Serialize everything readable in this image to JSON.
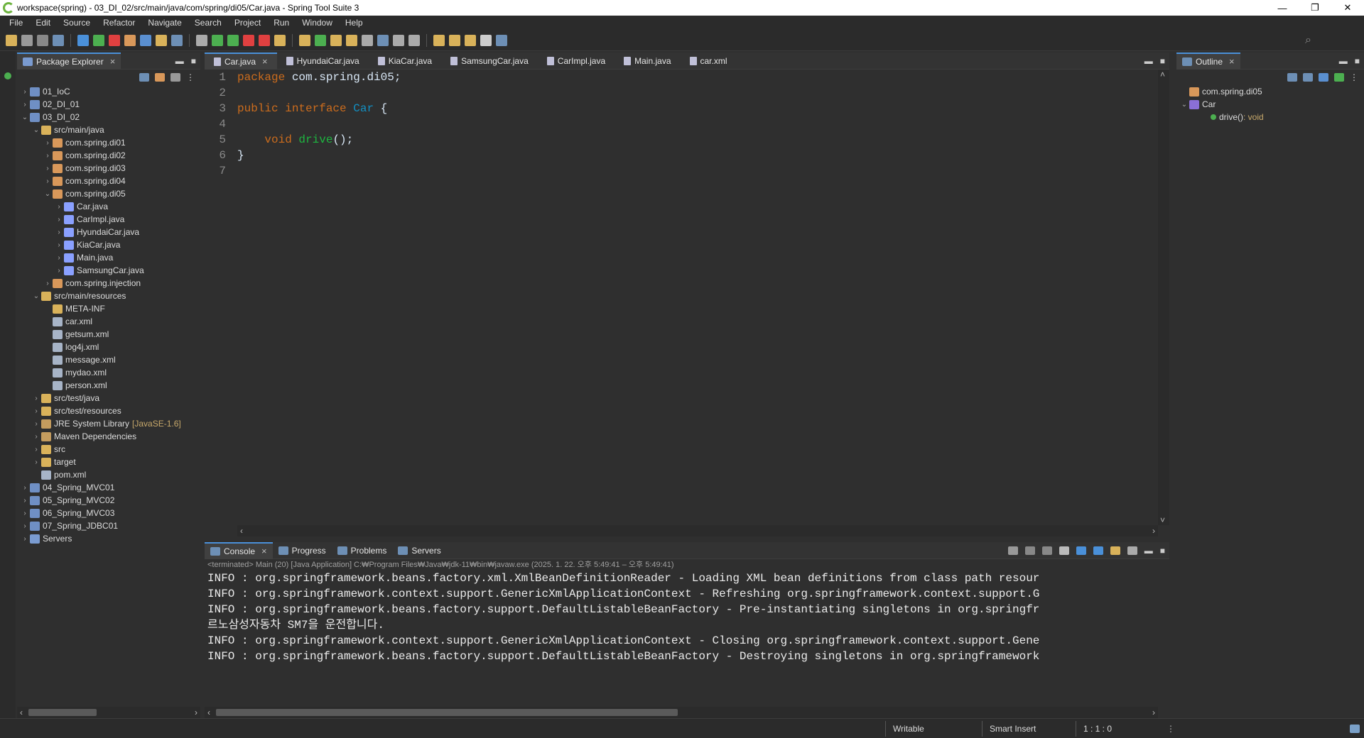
{
  "window": {
    "title": "workspace(spring) - 03_DI_02/src/main/java/com/spring/di05/Car.java - Spring Tool Suite 3",
    "minimize": "—",
    "restore": "❐",
    "close": "✕"
  },
  "menu": [
    "File",
    "Edit",
    "Source",
    "Refactor",
    "Navigate",
    "Search",
    "Project",
    "Run",
    "Window",
    "Help"
  ],
  "package_explorer": {
    "tab_label": "Package Explorer",
    "tree": [
      {
        "depth": 0,
        "twisty": "›",
        "icon": "project",
        "label": "01_IoC"
      },
      {
        "depth": 0,
        "twisty": "›",
        "icon": "project",
        "label": "02_DI_01"
      },
      {
        "depth": 0,
        "twisty": "⌄",
        "icon": "project",
        "label": "03_DI_02"
      },
      {
        "depth": 1,
        "twisty": "⌄",
        "icon": "folder",
        "label": "src/main/java"
      },
      {
        "depth": 2,
        "twisty": "›",
        "icon": "pkg",
        "label": "com.spring.di01"
      },
      {
        "depth": 2,
        "twisty": "›",
        "icon": "pkg",
        "label": "com.spring.di02"
      },
      {
        "depth": 2,
        "twisty": "›",
        "icon": "pkg",
        "label": "com.spring.di03"
      },
      {
        "depth": 2,
        "twisty": "›",
        "icon": "pkg",
        "label": "com.spring.di04"
      },
      {
        "depth": 2,
        "twisty": "⌄",
        "icon": "pkg",
        "label": "com.spring.di05"
      },
      {
        "depth": 3,
        "twisty": "›",
        "icon": "java",
        "label": "Car.java"
      },
      {
        "depth": 3,
        "twisty": "›",
        "icon": "java",
        "label": "CarImpl.java"
      },
      {
        "depth": 3,
        "twisty": "›",
        "icon": "java",
        "label": "HyundaiCar.java"
      },
      {
        "depth": 3,
        "twisty": "›",
        "icon": "java",
        "label": "KiaCar.java"
      },
      {
        "depth": 3,
        "twisty": "›",
        "icon": "java",
        "label": "Main.java"
      },
      {
        "depth": 3,
        "twisty": "›",
        "icon": "java",
        "label": "SamsungCar.java"
      },
      {
        "depth": 2,
        "twisty": "›",
        "icon": "pkg",
        "label": "com.spring.injection"
      },
      {
        "depth": 1,
        "twisty": "⌄",
        "icon": "folder",
        "label": "src/main/resources"
      },
      {
        "depth": 2,
        "twisty": "",
        "icon": "folder",
        "label": "META-INF"
      },
      {
        "depth": 2,
        "twisty": "",
        "icon": "xml",
        "label": "car.xml"
      },
      {
        "depth": 2,
        "twisty": "",
        "icon": "xml",
        "label": "getsum.xml"
      },
      {
        "depth": 2,
        "twisty": "",
        "icon": "xml",
        "label": "log4j.xml"
      },
      {
        "depth": 2,
        "twisty": "",
        "icon": "xml",
        "label": "message.xml"
      },
      {
        "depth": 2,
        "twisty": "",
        "icon": "xml",
        "label": "mydao.xml"
      },
      {
        "depth": 2,
        "twisty": "",
        "icon": "xml",
        "label": "person.xml"
      },
      {
        "depth": 1,
        "twisty": "›",
        "icon": "folder",
        "label": "src/test/java"
      },
      {
        "depth": 1,
        "twisty": "›",
        "icon": "folder",
        "label": "src/test/resources"
      },
      {
        "depth": 1,
        "twisty": "›",
        "icon": "lib",
        "label": "JRE System Library",
        "suffix": "[JavaSE-1.6]"
      },
      {
        "depth": 1,
        "twisty": "›",
        "icon": "lib",
        "label": "Maven Dependencies"
      },
      {
        "depth": 1,
        "twisty": "›",
        "icon": "folder",
        "label": "src"
      },
      {
        "depth": 1,
        "twisty": "›",
        "icon": "folder",
        "label": "target"
      },
      {
        "depth": 1,
        "twisty": "",
        "icon": "xml",
        "label": "pom.xml"
      },
      {
        "depth": 0,
        "twisty": "›",
        "icon": "project",
        "label": "04_Spring_MVC01"
      },
      {
        "depth": 0,
        "twisty": "›",
        "icon": "project",
        "label": "05_Spring_MVC02"
      },
      {
        "depth": 0,
        "twisty": "›",
        "icon": "project",
        "label": "06_Spring_MVC03"
      },
      {
        "depth": 0,
        "twisty": "›",
        "icon": "project",
        "label": "07_Spring_JDBC01"
      },
      {
        "depth": 0,
        "twisty": "›",
        "icon": "server",
        "label": "Servers"
      }
    ]
  },
  "editor": {
    "tabs": [
      {
        "label": "Car.java",
        "active": true
      },
      {
        "label": "HyundaiCar.java",
        "active": false
      },
      {
        "label": "KiaCar.java",
        "active": false
      },
      {
        "label": "SamsungCar.java",
        "active": false
      },
      {
        "label": "CarImpl.java",
        "active": false
      },
      {
        "label": "Main.java",
        "active": false
      },
      {
        "label": "car.xml",
        "active": false
      }
    ],
    "line_numbers": [
      "1",
      "2",
      "3",
      "4",
      "5",
      "6",
      "7"
    ],
    "lines": [
      [
        {
          "t": "package",
          "c": "kw"
        },
        {
          "t": " com.spring.di05;",
          "c": ""
        }
      ],
      [],
      [
        {
          "t": "public",
          "c": "kw"
        },
        {
          "t": " ",
          "c": ""
        },
        {
          "t": "interface",
          "c": "kw"
        },
        {
          "t": " ",
          "c": ""
        },
        {
          "t": "Car",
          "c": "ty"
        },
        {
          "t": " {",
          "c": ""
        }
      ],
      [],
      [
        {
          "t": "    ",
          "c": ""
        },
        {
          "t": "void",
          "c": "kw"
        },
        {
          "t": " ",
          "c": ""
        },
        {
          "t": "drive",
          "c": "mt"
        },
        {
          "t": "();",
          "c": ""
        }
      ],
      [
        {
          "t": "}",
          "c": ""
        }
      ],
      []
    ]
  },
  "outline": {
    "tab_label": "Outline",
    "items": [
      {
        "depth": 0,
        "twisty": "",
        "label": "com.spring.di05",
        "suffix": ""
      },
      {
        "depth": 0,
        "twisty": "⌄",
        "label": "Car",
        "suffix": ""
      },
      {
        "depth": 1,
        "twisty": "",
        "label": "drive()",
        "suffix": " : void"
      }
    ]
  },
  "console": {
    "tabs": [
      {
        "label": "Console",
        "active": true
      },
      {
        "label": "Progress",
        "active": false
      },
      {
        "label": "Problems",
        "active": false
      },
      {
        "label": "Servers",
        "active": false
      }
    ],
    "status_line": "<terminated> Main (20) [Java Application] C:₩Program Files₩Java₩jdk-11₩bin₩javaw.exe  (2025. 1. 22. 오후 5:49:41 – 오후 5:49:41)",
    "lines": [
      "INFO : org.springframework.beans.factory.xml.XmlBeanDefinitionReader - Loading XML bean definitions from class path resour",
      "INFO : org.springframework.context.support.GenericXmlApplicationContext - Refreshing org.springframework.context.support.G",
      "INFO : org.springframework.beans.factory.support.DefaultListableBeanFactory - Pre-instantiating singletons in org.springfr",
      "르노삼성자동차 SM7을 운전합니다.",
      "INFO : org.springframework.context.support.GenericXmlApplicationContext - Closing org.springframework.context.support.Gene",
      "INFO : org.springframework.beans.factory.support.DefaultListableBeanFactory - Destroying singletons in org.springframework"
    ]
  },
  "statusbar": {
    "writable": "Writable",
    "insert_mode": "Smart Insert",
    "position": "1 : 1 : 0"
  },
  "colors": {
    "keyword": "#cc6c1d",
    "type": "#1290c3",
    "method": "#1eb540",
    "background": "#2f2f2f",
    "accent": "#4a90d9"
  }
}
